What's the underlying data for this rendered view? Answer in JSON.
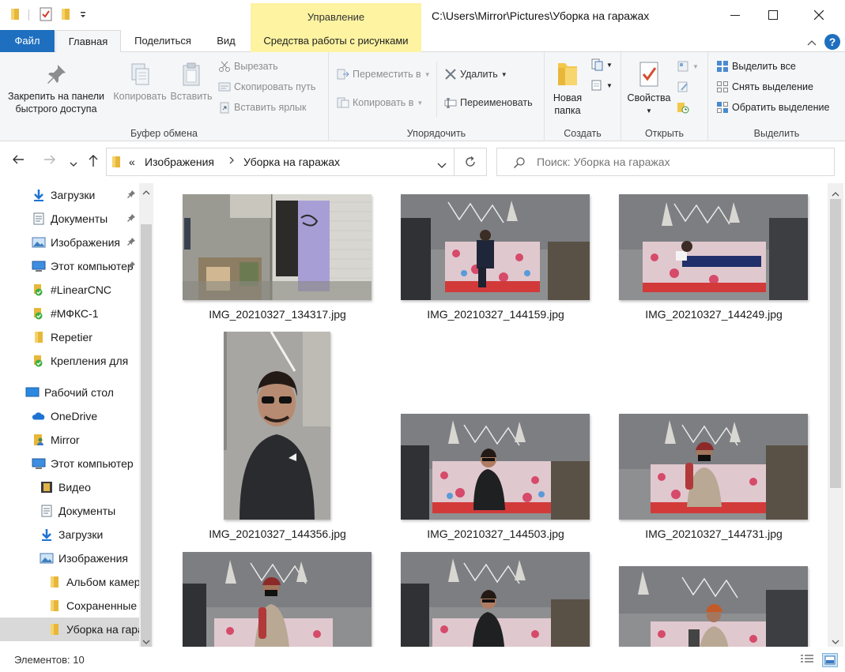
{
  "window": {
    "context_group": "Управление",
    "path_title": "C:\\Users\\Mirror\\Pictures\\Уборка на гаражах"
  },
  "tabs": {
    "file": "Файл",
    "home": "Главная",
    "share": "Поделиться",
    "view": "Вид",
    "picture_tools": "Средства работы с рисунками"
  },
  "ribbon": {
    "clipboard": {
      "pin_label": "Закрепить на панели быстрого доступа",
      "copy_label": "Копировать",
      "paste_label": "Вставить",
      "cut_label": "Вырезать",
      "copy_path_label": "Скопировать путь",
      "paste_shortcut_label": "Вставить ярлык",
      "group_label": "Буфер обмена"
    },
    "organize": {
      "move_to_label": "Переместить в",
      "copy_to_label": "Копировать в",
      "delete_label": "Удалить",
      "rename_label": "Переименовать",
      "group_label": "Упорядочить"
    },
    "new": {
      "new_folder_label": "Новая папка",
      "group_label": "Создать"
    },
    "open": {
      "properties_label": "Свойства",
      "group_label": "Открыть"
    },
    "select": {
      "select_all_label": "Выделить все",
      "select_none_label": "Снять выделение",
      "invert_selection_label": "Обратить выделение",
      "group_label": "Выделить"
    }
  },
  "address": {
    "overflow": "«",
    "crumbs": [
      "Изображения",
      "Уборка на гаражах"
    ],
    "search_placeholder": "Поиск: Уборка на гаражах"
  },
  "nav": {
    "items": [
      {
        "label": "Загрузки",
        "icon": "download-arrow-icon",
        "pinned": true
      },
      {
        "label": "Документы",
        "icon": "document-icon",
        "pinned": true
      },
      {
        "label": "Изображения",
        "icon": "pictures-icon",
        "pinned": true
      },
      {
        "label": "Этот компьютер",
        "icon": "computer-icon",
        "pinned": true
      },
      {
        "label": "#LinearCNC",
        "icon": "synced-folder-icon",
        "pinned": false
      },
      {
        "label": "#МФКС-1",
        "icon": "synced-folder-icon",
        "pinned": false
      },
      {
        "label": "Repetier",
        "icon": "folder-icon",
        "pinned": false
      },
      {
        "label": "Крепления для",
        "icon": "synced-folder-icon",
        "pinned": false
      },
      {
        "label": "Рабочий стол",
        "icon": "desktop-icon",
        "pinned": false
      },
      {
        "label": "OneDrive",
        "icon": "cloud-icon",
        "pinned": false
      },
      {
        "label": "Mirror",
        "icon": "user-icon",
        "pinned": false
      },
      {
        "label": "Этот компьютер",
        "icon": "computer-icon",
        "pinned": false
      },
      {
        "label": "Видео",
        "icon": "video-icon",
        "pinned": false
      },
      {
        "label": "Документы",
        "icon": "document-icon",
        "pinned": false
      },
      {
        "label": "Загрузки",
        "icon": "download-arrow-icon",
        "pinned": false
      },
      {
        "label": "Изображения",
        "icon": "pictures-icon",
        "pinned": false
      },
      {
        "label": "Альбом камеры",
        "icon": "folder-icon",
        "pinned": false
      },
      {
        "label": "Сохраненные",
        "icon": "folder-icon",
        "pinned": false
      },
      {
        "label": "Уборка на гаражах",
        "icon": "folder-icon",
        "pinned": false
      }
    ]
  },
  "files": [
    "IMG_20210327_134317.jpg",
    "IMG_20210327_144159.jpg",
    "IMG_20210327_144249.jpg",
    "IMG_20210327_144356.jpg",
    "IMG_20210327_144503.jpg",
    "IMG_20210327_144731.jpg"
  ],
  "status": {
    "items_count": "Элементов: 10"
  }
}
